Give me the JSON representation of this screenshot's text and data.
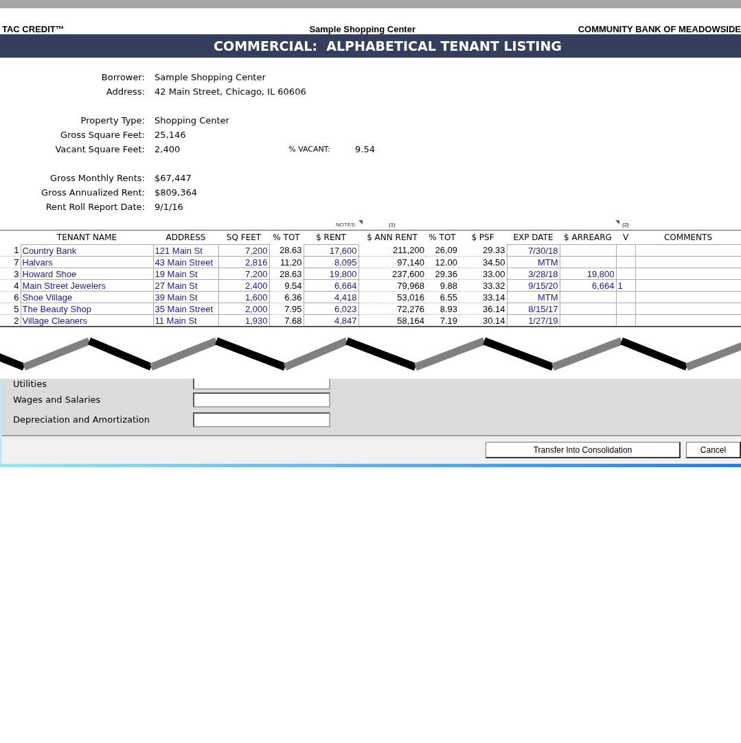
{
  "header": {
    "left": "TAC CREDIT™",
    "center": "Sample Shopping Center",
    "right": "COMMUNITY BANK OF MEADOWSIDE"
  },
  "title": "COMMERCIAL:  ALPHABETICAL TENANT LISTING",
  "info_groups": [
    [
      {
        "label": "Borrower:",
        "value": "Sample Shopping Center"
      },
      {
        "label": "Address:",
        "value": "42 Main Street, Chicago, IL 60606"
      }
    ],
    [
      {
        "label": "Property Type:",
        "value": "Shopping Center"
      },
      {
        "label": "Gross Square Feet:",
        "value": "25,146"
      },
      {
        "label": "Vacant Square Feet:",
        "value": "2,400",
        "extra_label": "% VACANT:",
        "extra_value": "9.54"
      }
    ],
    [
      {
        "label": "Gross Monthly Rents:",
        "value": "$67,447"
      },
      {
        "label": "Gross Annualized Rent:",
        "value": "$809,364"
      },
      {
        "label": "Rent Roll Report Date:",
        "value": "9/1/16"
      }
    ]
  ],
  "notes": {
    "label": "NOTES:",
    "note_1": "(1)",
    "note_2": "(2)"
  },
  "table": {
    "columns": [
      "",
      "TENANT NAME",
      "ADDRESS",
      "SQ FEET",
      "% TOT",
      "$  RENT",
      "$ ANN RENT",
      "% TOT",
      "$ PSF",
      "EXP DATE",
      "$ ARREARG",
      "V",
      "COMMENTS"
    ],
    "rows": [
      {
        "no": "1",
        "tenant": "Country Bank",
        "address": "121 Main St",
        "sq_feet": "7,200",
        "pct_tot": "28.63",
        "rent": "17,600",
        "ann_rent": "211,200",
        "ann_pct": "26.09",
        "psf": "29.33",
        "exp_date": "7/30/18"
      },
      {
        "no": "7",
        "tenant": "Halvars",
        "address": "43 Main Street",
        "sq_feet": "2,816",
        "pct_tot": "11.20",
        "rent": "8,095",
        "ann_rent": "97,140",
        "ann_pct": "12.00",
        "psf": "34.50",
        "exp_date": "MTM"
      },
      {
        "no": "3",
        "tenant": "Howard Shoe",
        "address": "19 Main St",
        "sq_feet": "7,200",
        "pct_tot": "28.63",
        "rent": "19,800",
        "ann_rent": "237,600",
        "ann_pct": "29.36",
        "psf": "33.00",
        "exp_date": "3/28/18",
        "arrears": "19,800"
      },
      {
        "no": "4",
        "tenant": "Main Street Jewelers",
        "address": "27 Main St",
        "sq_feet": "2,400",
        "pct_tot": "9.54",
        "rent": "6,664",
        "ann_rent": "79,968",
        "ann_pct": "9.88",
        "psf": "33.32",
        "exp_date": "9/15/20",
        "arrears": "6,664",
        "v": "1"
      },
      {
        "no": "6",
        "tenant": "Shoe Village",
        "address": "39 Main St",
        "sq_feet": "1,600",
        "pct_tot": "6.36",
        "rent": "4,418",
        "ann_rent": "53,016",
        "ann_pct": "6.55",
        "psf": "33.14",
        "exp_date": "MTM"
      },
      {
        "no": "5",
        "tenant": "The Beauty Shop",
        "address": "35 Main Street",
        "sq_feet": "2,000",
        "pct_tot": "7.95",
        "rent": "6,023",
        "ann_rent": "72,276",
        "ann_pct": "8.93",
        "psf": "36.14",
        "exp_date": "8/15/17"
      },
      {
        "no": "2",
        "tenant": "Village Cleaners",
        "address": "11 Main St",
        "sq_feet": "1,930",
        "pct_tot": "7.68",
        "rent": "4,847",
        "ann_rent": "58,164",
        "ann_pct": "7.19",
        "psf": "30.14",
        "exp_date": "1/27/19"
      }
    ]
  },
  "dialog": {
    "fields": [
      {
        "label": "Utilities"
      },
      {
        "label": "Wages and Salaries"
      },
      {
        "label": "Depreciation and Amortization"
      }
    ],
    "buttons": [
      "Transfer Into Consolidation",
      "Cancel"
    ]
  }
}
